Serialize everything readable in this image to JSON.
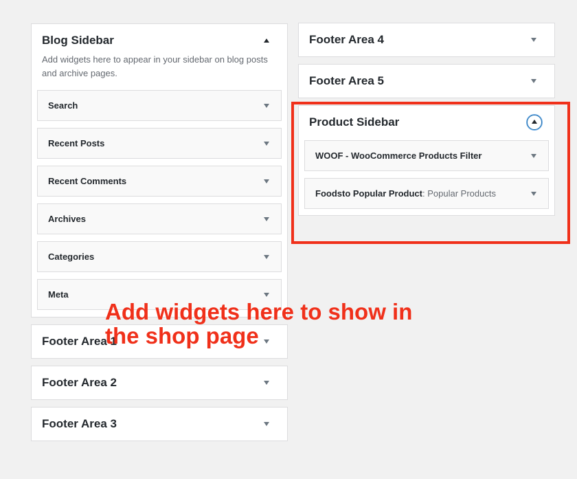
{
  "blog_sidebar": {
    "title": "Blog Sidebar",
    "description": "Add widgets here to appear in your sidebar on blog posts and archive pages.",
    "widgets": [
      {
        "title": "Search"
      },
      {
        "title": "Recent Posts"
      },
      {
        "title": "Recent Comments"
      },
      {
        "title": "Archives"
      },
      {
        "title": "Categories"
      },
      {
        "title": "Meta"
      }
    ]
  },
  "footer_areas_left": [
    {
      "title": "Footer Area 1"
    },
    {
      "title": "Footer Area 2"
    },
    {
      "title": "Footer Area 3"
    }
  ],
  "footer_areas_right": [
    {
      "title": "Footer Area 4"
    },
    {
      "title": "Footer Area 5"
    }
  ],
  "product_sidebar": {
    "title": "Product Sidebar",
    "widgets": [
      {
        "title": "WOOF - WooCommerce Products Filter",
        "subtitle": ""
      },
      {
        "title": "Foodsto Popular Product",
        "subtitle": ": Popular Products"
      }
    ]
  },
  "annotation": {
    "line1": "Add widgets here to show in",
    "line2": "the shop page",
    "color": "#f0301a"
  },
  "icons": {
    "collapse": "arrow-up-icon",
    "expand": "arrow-down-icon"
  }
}
